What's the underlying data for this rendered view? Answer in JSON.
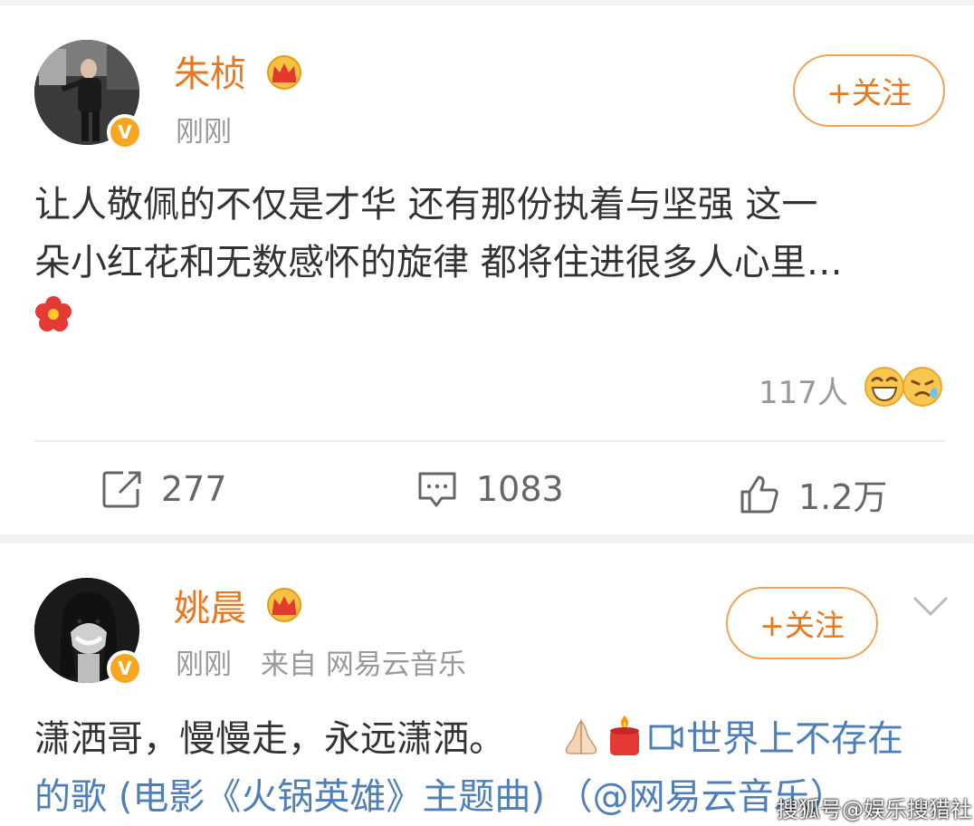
{
  "posts": [
    {
      "author": "朱桢",
      "time": "刚刚",
      "follow_label": "+关注",
      "text_line1": "让人敬佩的不仅是才华 还有那份执着与坚强 这一",
      "text_line2": "朵小红花和无数感怀的旋律 都将住进很多人心里…",
      "reaction_count": "117人",
      "actions": {
        "repost": "277",
        "comment": "1083",
        "like": "1.2万"
      }
    },
    {
      "author": "姚晨",
      "time": "刚刚",
      "source": "来自 网易云音乐",
      "follow_label": "+关注",
      "text_line1_plain": "潇洒哥，慢慢走，永远潇洒。",
      "text_line1_link": "世界上不存在",
      "text_line2_link": "的歌 (电影《火锅英雄》主题曲)",
      "text_line2_plain": " （@网易云音乐）"
    }
  ],
  "watermark": "搜狐号@娱乐搜猎社",
  "colors": {
    "accent": "#e8771e",
    "link": "#4e7fb8",
    "verified": "#f5a623"
  },
  "icons": [
    "crown-vip-icon",
    "verified-v-icon",
    "red-flower-icon",
    "laugh-emoji-icon",
    "sad-emoji-icon",
    "repost-icon",
    "comment-icon",
    "like-icon",
    "chevron-down-icon",
    "pray-hands-icon",
    "candle-icon",
    "video-link-icon"
  ]
}
